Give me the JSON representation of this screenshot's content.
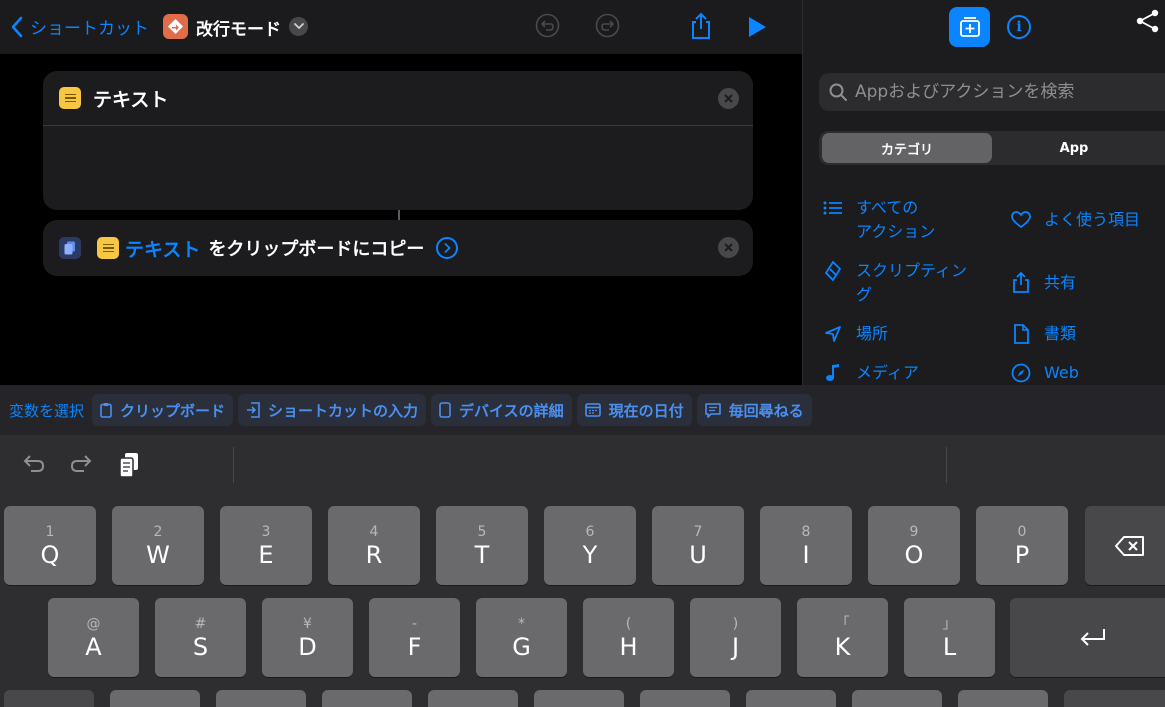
{
  "nav": {
    "back_label": "ショートカット",
    "title": "改行モード"
  },
  "editor": {
    "text_card": {
      "title": "テキスト"
    },
    "copy_card": {
      "variable_label": "テキスト",
      "action_label": "をクリップボードにコピー"
    }
  },
  "sidebar": {
    "search_placeholder": "Appおよびアクションを検索",
    "segments": [
      "カテゴリ",
      "App"
    ],
    "categories": [
      {
        "label": "すべての",
        "label2": "アクション",
        "icon": "list-icon"
      },
      {
        "label": "よく使う項目",
        "icon": "heart-icon"
      },
      {
        "label": "スクリプティン",
        "label2": "グ",
        "icon": "scripting-icon"
      },
      {
        "label": "共有",
        "icon": "share-icon"
      },
      {
        "label": "場所",
        "icon": "location-icon"
      },
      {
        "label": "書類",
        "icon": "document-icon"
      },
      {
        "label": "メディア",
        "icon": "music-icon"
      },
      {
        "label": "Web",
        "icon": "compass-icon"
      }
    ]
  },
  "variable_bar": {
    "label": "変数を選択",
    "chips": [
      "クリップボード",
      "ショートカットの入力",
      "デバイスの詳細",
      "現在の日付",
      "毎回尋ねる"
    ]
  },
  "keyboard": {
    "row1": [
      {
        "hint": "1",
        "key": "Q"
      },
      {
        "hint": "2",
        "key": "W"
      },
      {
        "hint": "3",
        "key": "E"
      },
      {
        "hint": "4",
        "key": "R"
      },
      {
        "hint": "5",
        "key": "T"
      },
      {
        "hint": "6",
        "key": "Y"
      },
      {
        "hint": "7",
        "key": "U"
      },
      {
        "hint": "8",
        "key": "I"
      },
      {
        "hint": "9",
        "key": "O"
      },
      {
        "hint": "0",
        "key": "P"
      }
    ],
    "row2": [
      {
        "hint": "@",
        "key": "A"
      },
      {
        "hint": "#",
        "key": "S"
      },
      {
        "hint": "¥",
        "key": "D"
      },
      {
        "hint": "-",
        "key": "F"
      },
      {
        "hint": "*",
        "key": "G"
      },
      {
        "hint": "(",
        "key": "H"
      },
      {
        "hint": ")",
        "key": "J"
      },
      {
        "hint": "「",
        "key": "K"
      },
      {
        "hint": "」",
        "key": "L"
      }
    ]
  },
  "colors": {
    "accent": "#0a84ff",
    "note_yellow": "#f7c744",
    "shortcut_orange": "#e06d4a"
  }
}
